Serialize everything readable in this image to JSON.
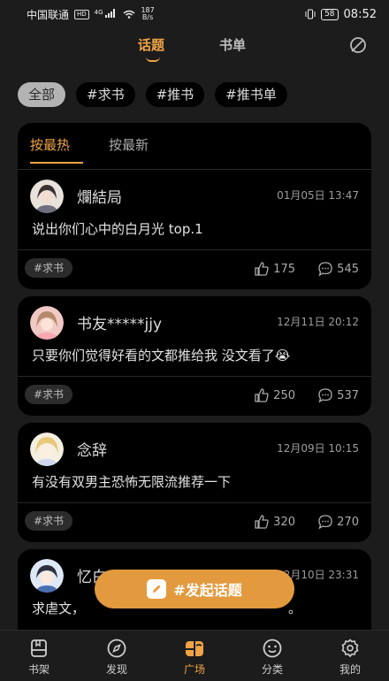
{
  "status_bar": {
    "carrier": "中国联通",
    "hd": "HD",
    "network": "4G",
    "speed_value": "187",
    "speed_unit": "B/s",
    "battery": "58",
    "time": "08:52"
  },
  "header": {
    "tabs": [
      {
        "label": "话题",
        "active": true
      },
      {
        "label": "书单",
        "active": false
      }
    ]
  },
  "filters": [
    "全部",
    "#求书",
    "#推书",
    "#推书单"
  ],
  "sort": {
    "hot": "按最热",
    "new": "按最新"
  },
  "posts": [
    {
      "user": "爛結局",
      "time": "01月05日 13:47",
      "text": "说出你们心中的白月光 top.1",
      "tag": "#求书",
      "likes": "175",
      "comments": "545"
    },
    {
      "user": "书友*****jjy",
      "time": "12月11日 20:12",
      "text": "只要你们觉得好看的文都推给我 没文看了😭",
      "tag": "#求书",
      "likes": "250",
      "comments": "537"
    },
    {
      "user": "念辞",
      "time": "12月09日 10:15",
      "text": "有没有双男主恐怖无限流推荐一下",
      "tag": "#求书",
      "likes": "320",
      "comments": "270"
    },
    {
      "user": "忆白",
      "time": "12月10日 23:31",
      "text": "求虐文，",
      "text_tail": "。",
      "tag": "",
      "likes": "",
      "comments": ""
    }
  ],
  "fab": {
    "label": "#发起话题"
  },
  "bottom_nav": [
    {
      "label": "书架",
      "icon": "bookshelf-icon"
    },
    {
      "label": "发现",
      "icon": "compass-icon"
    },
    {
      "label": "广场",
      "icon": "square-icon",
      "active": true
    },
    {
      "label": "分类",
      "icon": "smile-icon"
    },
    {
      "label": "我的",
      "icon": "gear-icon"
    }
  ],
  "colors": {
    "accent": "#f0a445",
    "card": "#000000",
    "background": "#1c1c1c"
  }
}
